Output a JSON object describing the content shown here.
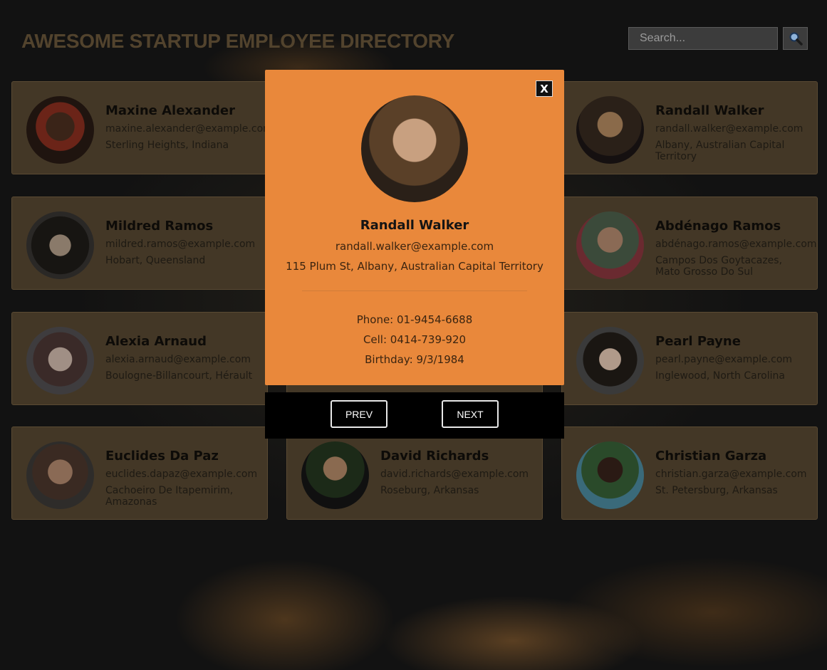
{
  "header": {
    "title": "AWESOME STARTUP EMPLOYEE DIRECTORY"
  },
  "search": {
    "placeholder": "Search..."
  },
  "employees": [
    {
      "name": "Maxine Alexander",
      "email": "maxine.alexander@example.com",
      "location": "Sterling Heights, Indiana"
    },
    {
      "name": "Randall Walker",
      "email": "randall.walker@example.com",
      "location": "Albany, Australian Capital Territory"
    },
    {
      "name": "Mildred Ramos",
      "email": "mildred.ramos@example.com",
      "location": "Hobart, Queensland"
    },
    {
      "name": "Abdénago Ramos",
      "email": "abdénago.ramos@example.com",
      "location": "Campos Dos Goytacazes, Mato Grosso Do Sul"
    },
    {
      "name": "Alexia Arnaud",
      "email": "alexia.arnaud@example.com",
      "location": "Boulogne-Billancourt, Hérault"
    },
    {
      "name": "Pearl Payne",
      "email": "pearl.payne@example.com",
      "location": "Inglewood, North Carolina"
    },
    {
      "name": "Euclides Da Paz",
      "email": "euclides.dapaz@example.com",
      "location": "Cachoeiro De Itapemirim, Amazonas"
    },
    {
      "name": "David Richards",
      "email": "david.richards@example.com",
      "location": "Roseburg, Arkansas"
    },
    {
      "name": "Christian Garza",
      "email": "christian.garza@example.com",
      "location": "St. Petersburg, Arkansas"
    }
  ],
  "modal": {
    "close_label": "X",
    "name": "Randall Walker",
    "email": "randall.walker@example.com",
    "address": "115 Plum St, Albany, Australian Capital Territory",
    "phone": "Phone: 01-9454-6688",
    "cell": "Cell: 0414-739-920",
    "birthday": "Birthday: 9/3/1984",
    "prev_label": "PREV",
    "next_label": "NEXT"
  },
  "colors": {
    "accent": "#e9883b",
    "card_bg": "#433726",
    "page_bg": "#121212"
  },
  "icons": {
    "search": "magnifier-icon",
    "close": "close-icon"
  }
}
